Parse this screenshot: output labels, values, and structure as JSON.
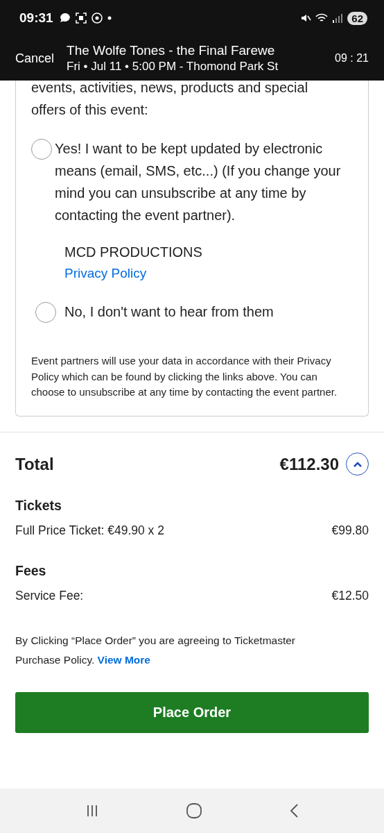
{
  "status_bar": {
    "time": "09:31",
    "battery": "62"
  },
  "header": {
    "cancel": "Cancel",
    "title": "The Wolfe Tones - the Final Farewe",
    "subtitle": "Fri • Jul 11 • 5:00 PM - Thomond Park St",
    "timer": "09 : 21"
  },
  "consent": {
    "intro": "events, activities, news, products and special offers of this event:",
    "options": [
      {
        "label": "Yes! I want to be kept updated by electronic means (email, SMS, etc...) (If you change your mind you can unsubscribe at any time by contacting the event partner).",
        "selected": false
      },
      {
        "label": "No, I don't want to hear from them",
        "selected": false
      }
    ],
    "partner": "MCD PRODUCTIONS",
    "privacy_link": "Privacy Policy",
    "note": "Event partners will use your data in accordance with their Privacy Policy which can be found by clicking the links above. You can choose to unsubscribe at any time by contacting the event partner."
  },
  "total": {
    "label": "Total",
    "amount": "€112.30",
    "expanded": true
  },
  "sections": [
    {
      "heading": "Tickets",
      "lines": [
        {
          "label": "Full Price Ticket: €49.90 x 2",
          "amount": "€99.80"
        }
      ]
    },
    {
      "heading": "Fees",
      "lines": [
        {
          "label": "Service Fee:",
          "amount": "€12.50"
        }
      ]
    }
  ],
  "policy": {
    "text": "By Clicking “Place Order” you are agreeing to Ticketmaster Purchase Policy.",
    "link": "View More"
  },
  "place_order": "Place Order"
}
